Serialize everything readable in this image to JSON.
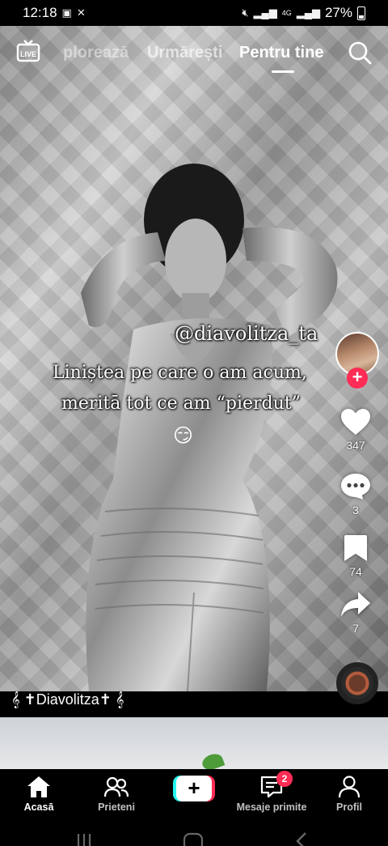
{
  "status_bar": {
    "time": "12:18",
    "network": "4G",
    "battery": "27%"
  },
  "top_nav": {
    "live_label": "LIVE",
    "tabs": [
      {
        "label": "ploreazā"
      },
      {
        "label": "Urmārești"
      },
      {
        "label": "Pentru tine",
        "active": true
      }
    ]
  },
  "video": {
    "overlay_handle": "@diavolitza_ta",
    "caption_line1": "Liniștea pe care o am acum,",
    "caption_line2": "meritā tot ce am “pierdut”",
    "emoji": "😏"
  },
  "actions": {
    "like_count": "347",
    "comment_count": "3",
    "save_count": "74",
    "share_count": "7"
  },
  "author": {
    "display_name": " ✝Diavolitza✝ "
  },
  "bottom_nav": {
    "home": "Acasā",
    "friends": "Prieteni",
    "inbox": "Mesaje primite",
    "inbox_badge": "2",
    "profile": "Profil"
  },
  "colors": {
    "accent": "#fe2c55",
    "accent_cyan": "#25f4ee",
    "background": "#000000"
  }
}
